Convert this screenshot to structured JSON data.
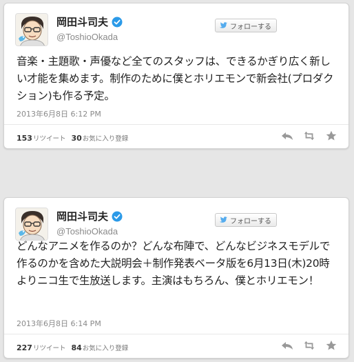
{
  "tweets": [
    {
      "display_name": "岡田斗司夫",
      "screen_name": "@ToshioOkada",
      "follow_label": "フォローする",
      "text": "音楽・主題歌・声優など全てのスタッフは、できるかぎり広く新しい才能を集めます。制作のために僕とホリエモンで新会社(プロダクション)も作る予定。",
      "timestamp": "2013年6月8日 6:12 PM",
      "retweets_count": "153",
      "retweets_label": "リツイート",
      "favorites_count": "30",
      "favorites_label": "お気に入り登録"
    },
    {
      "display_name": "岡田斗司夫",
      "screen_name": "@ToshioOkada",
      "follow_label": "フォローする",
      "text": "どんなアニメを作るのか？どんな布陣で、どんなビジネスモデルで作るのかを含めた大説明会＋制作発表ベータ版を6月13日(木)20時よりニコ生で生放送します。主演はもちろん、僕とホリエモン！",
      "timestamp": "2013年6月8日 6:14 PM",
      "retweets_count": "227",
      "retweets_label": "リツイート",
      "favorites_count": "84",
      "favorites_label": "お気に入り登録"
    }
  ],
  "icons": {
    "verified": "verified-badge-icon",
    "follow_bird": "twitter-bird-icon",
    "reply": "reply-icon",
    "retweet": "retweet-icon",
    "favorite": "star-icon"
  },
  "colors": {
    "background": "#e6e6e6",
    "card": "#ffffff",
    "verified_blue": "#2b9ae8",
    "action_gray": "#999999",
    "meta_gray": "#8a8a8a"
  }
}
